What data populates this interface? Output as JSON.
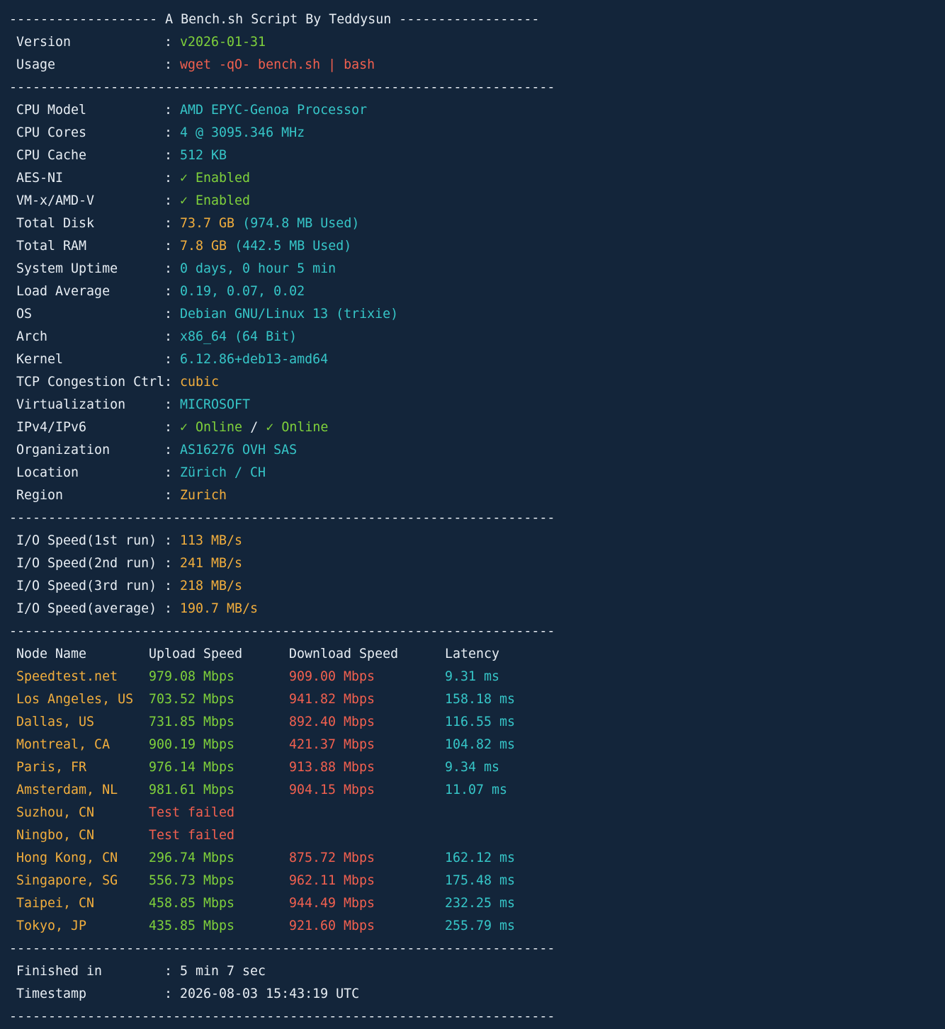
{
  "separators": {
    "title": "------------------- A Bench.sh Script By Teddysun ------------------",
    "line": "----------------------------------------------------------------------"
  },
  "header": {
    "version_label": "Version",
    "version_value": "v2026-01-31",
    "usage_label": "Usage",
    "usage_value": "wget -qO- bench.sh | bash"
  },
  "system": [
    {
      "label": "CPU Model",
      "value": "AMD EPYC-Genoa Processor",
      "color": "cyan"
    },
    {
      "label": "CPU Cores",
      "value": "4 @ 3095.346 MHz",
      "color": "cyan"
    },
    {
      "label": "CPU Cache",
      "value": "512 KB",
      "color": "cyan"
    },
    {
      "label": "AES-NI",
      "value": "✓ Enabled",
      "color": "green"
    },
    {
      "label": "VM-x/AMD-V",
      "value": "✓ Enabled",
      "color": "green"
    },
    {
      "label": "Total Disk",
      "value": "73.7 GB",
      "value2": "(974.8 MB Used)",
      "color": "yellow",
      "color2": "cyan"
    },
    {
      "label": "Total RAM",
      "value": "7.8 GB",
      "value2": "(442.5 MB Used)",
      "color": "yellow",
      "color2": "cyan"
    },
    {
      "label": "System Uptime",
      "value": "0 days, 0 hour 5 min",
      "color": "cyan"
    },
    {
      "label": "Load Average",
      "value": "0.19, 0.07, 0.02",
      "color": "cyan"
    },
    {
      "label": "OS",
      "value": "Debian GNU/Linux 13 (trixie)",
      "color": "cyan"
    },
    {
      "label": "Arch",
      "value": "x86_64 (64 Bit)",
      "color": "cyan"
    },
    {
      "label": "Kernel",
      "value": "6.12.86+deb13-amd64",
      "color": "cyan"
    },
    {
      "label": "TCP Congestion Ctrl",
      "value": "cubic",
      "color": "yellow"
    },
    {
      "label": "Virtualization",
      "value": "MICROSOFT",
      "color": "cyan"
    },
    {
      "label": "IPv4/IPv6",
      "value": "✓ Online",
      "sep": "/",
      "value2": "✓ Online",
      "color": "green",
      "color2": "green"
    },
    {
      "label": "Organization",
      "value": "AS16276 OVH SAS",
      "color": "cyan"
    },
    {
      "label": "Location",
      "value": "Zürich / CH",
      "color": "cyan"
    },
    {
      "label": "Region",
      "value": "Zurich",
      "color": "yellow"
    }
  ],
  "io": [
    {
      "label": "I/O Speed(1st run)",
      "value": "113 MB/s"
    },
    {
      "label": "I/O Speed(2nd run)",
      "value": "241 MB/s"
    },
    {
      "label": "I/O Speed(3rd run)",
      "value": "218 MB/s"
    },
    {
      "label": "I/O Speed(average)",
      "value": "190.7 MB/s"
    }
  ],
  "speedtest": {
    "headers": [
      "Node Name",
      "Upload Speed",
      "Download Speed",
      "Latency"
    ],
    "rows": [
      {
        "node": "Speedtest.net",
        "up": "979.08 Mbps",
        "down": "909.00 Mbps",
        "lat": "9.31 ms"
      },
      {
        "node": "Los Angeles, US",
        "up": "703.52 Mbps",
        "down": "941.82 Mbps",
        "lat": "158.18 ms"
      },
      {
        "node": "Dallas, US",
        "up": "731.85 Mbps",
        "down": "892.40 Mbps",
        "lat": "116.55 ms"
      },
      {
        "node": "Montreal, CA",
        "up": "900.19 Mbps",
        "down": "421.37 Mbps",
        "lat": "104.82 ms"
      },
      {
        "node": "Paris, FR",
        "up": "976.14 Mbps",
        "down": "913.88 Mbps",
        "lat": "9.34 ms"
      },
      {
        "node": "Amsterdam, NL",
        "up": "981.61 Mbps",
        "down": "904.15 Mbps",
        "lat": "11.07 ms"
      },
      {
        "node": "Suzhou, CN",
        "failed": "Test failed"
      },
      {
        "node": "Ningbo, CN",
        "failed": "Test failed"
      },
      {
        "node": "Hong Kong, CN",
        "up": "296.74 Mbps",
        "down": "875.72 Mbps",
        "lat": "162.12 ms"
      },
      {
        "node": "Singapore, SG",
        "up": "556.73 Mbps",
        "down": "962.11 Mbps",
        "lat": "175.48 ms"
      },
      {
        "node": "Taipei, CN",
        "up": "458.85 Mbps",
        "down": "944.49 Mbps",
        "lat": "232.25 ms"
      },
      {
        "node": "Tokyo, JP",
        "up": "435.85 Mbps",
        "down": "921.60 Mbps",
        "lat": "255.79 ms"
      }
    ]
  },
  "footer": {
    "finished_label": "Finished in",
    "finished_value": "5 min 7 sec",
    "timestamp_label": "Timestamp",
    "timestamp_value": "2026-08-03 15:43:19 UTC"
  },
  "colors": {
    "background": "#13253a",
    "text": "#e8eef4",
    "green": "#7fd13b",
    "red": "#f2604f",
    "cyan": "#36c6c8",
    "yellow": "#f2ae3d"
  }
}
